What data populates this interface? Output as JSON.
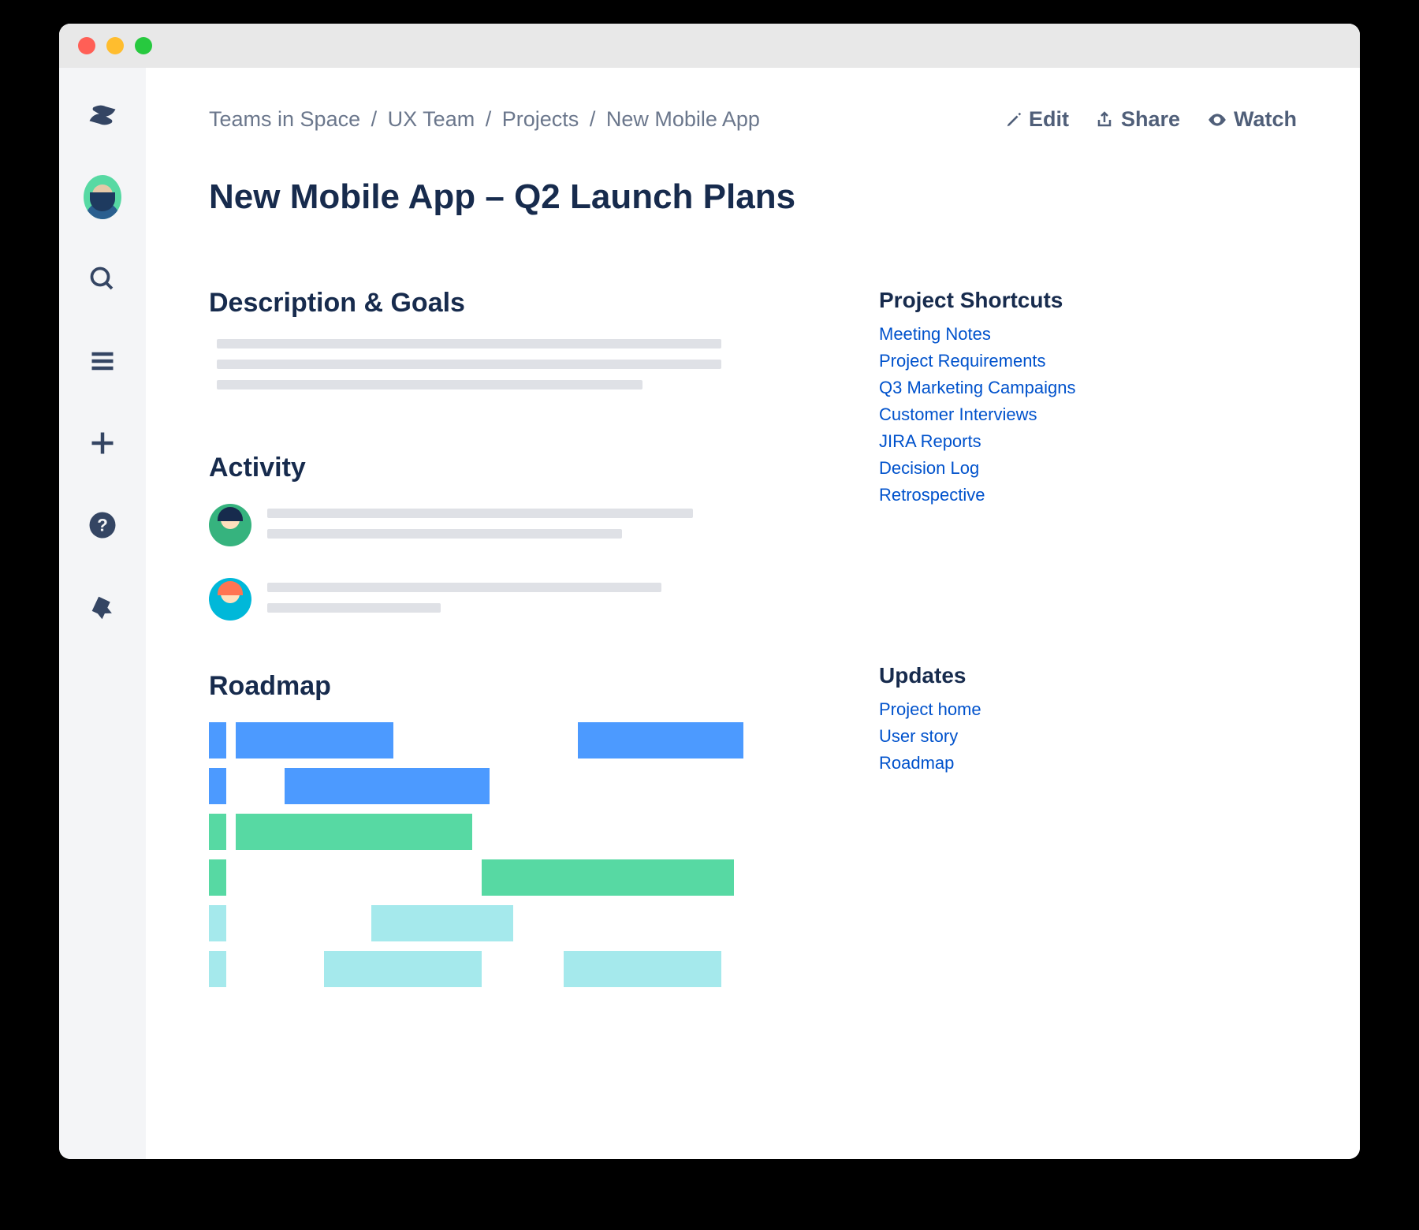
{
  "breadcrumb": [
    "Teams in Space",
    "UX Team",
    "Projects",
    "New Mobile App"
  ],
  "actions": {
    "edit": "Edit",
    "share": "Share",
    "watch": "Watch"
  },
  "page_title": "New Mobile App – Q2 Launch Plans",
  "sections": {
    "description": "Description & Goals",
    "activity": "Activity",
    "roadmap": "Roadmap"
  },
  "shortcuts": {
    "title": "Project Shortcuts",
    "items": [
      "Meeting Notes",
      "Project Requirements",
      "Q3 Marketing Campaigns",
      "Customer Interviews",
      "JIRA Reports",
      "Decision Log",
      "Retrospective"
    ]
  },
  "updates": {
    "title": "Updates",
    "items": [
      "Project home",
      "User story",
      "Roadmap"
    ]
  },
  "sidebar_icons": [
    "confluence-logo-icon",
    "avatar-icon",
    "search-icon",
    "menu-icon",
    "plus-icon",
    "help-icon",
    "notification-icon"
  ]
}
